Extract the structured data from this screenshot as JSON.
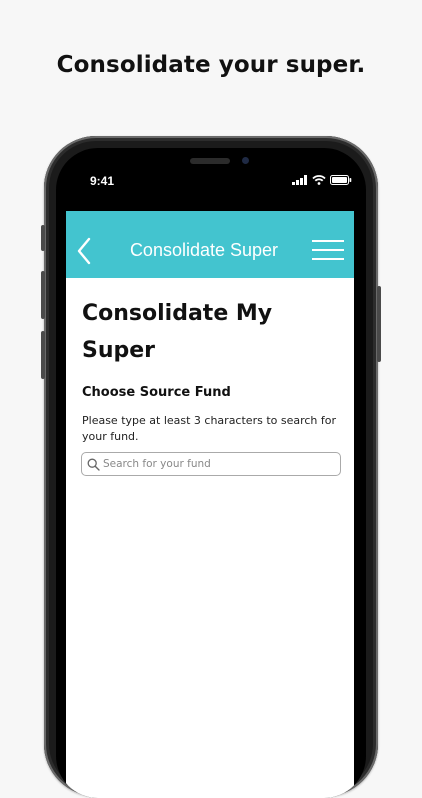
{
  "promo": {
    "headline": "Consolidate your super."
  },
  "status_bar": {
    "time": "9:41"
  },
  "navbar": {
    "title": "Consolidate Super",
    "back_icon": "chevron-left-icon",
    "menu_icon": "hamburger-menu-icon"
  },
  "page": {
    "title": "Consolidate My Super",
    "section_title": "Choose Source Fund",
    "help_text": "Please type at least 3 characters to search for your fund."
  },
  "search": {
    "placeholder": "Search for your fund",
    "value": "",
    "icon": "search-icon"
  },
  "colors": {
    "navbar": "#43c4cf",
    "background": "#f7f7f7",
    "text": "#111111"
  }
}
